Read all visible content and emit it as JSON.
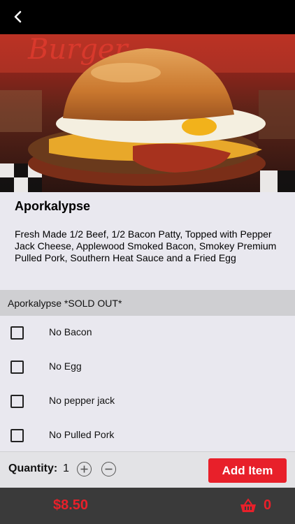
{
  "header": {
    "back_icon": "chevron-left-icon"
  },
  "item": {
    "image_alt": "burger-photo",
    "name": "Aporkalypse",
    "description": "Fresh Made 1/2 Beef, 1/2 Bacon Patty, Topped with Pepper Jack Cheese, Applewood Smoked Bacon, Smokey Premium Pulled Pork, Southern Heat Sauce and a Fried Egg"
  },
  "options_section": {
    "title": "Aporkalypse *SOLD OUT*",
    "options": [
      {
        "label": "No Bacon",
        "checked": false
      },
      {
        "label": "No Egg",
        "checked": false
      },
      {
        "label": "No pepper jack",
        "checked": false
      },
      {
        "label": "No Pulled Pork",
        "checked": false
      }
    ]
  },
  "quantity": {
    "label": "Quantity:",
    "value": "1"
  },
  "add_button": {
    "label": "Add Item"
  },
  "footer": {
    "price": "$8.50",
    "cart_count": "0",
    "cart_icon": "basket-icon"
  },
  "colors": {
    "accent": "#e8202a",
    "footer_bg": "#3a3a3a",
    "page_bg": "#e9e8ef"
  }
}
